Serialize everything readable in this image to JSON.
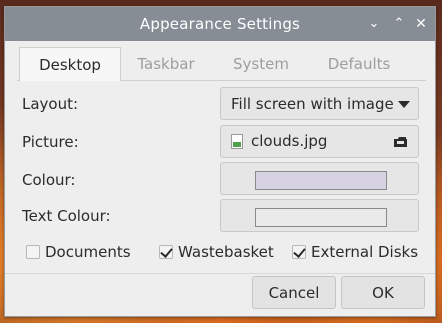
{
  "window": {
    "title": "Appearance Settings"
  },
  "tabs": [
    {
      "label": "Desktop"
    },
    {
      "label": "Taskbar"
    },
    {
      "label": "System"
    },
    {
      "label": "Defaults"
    }
  ],
  "form": {
    "layout": {
      "label": "Layout:",
      "value": "Fill screen with image"
    },
    "picture": {
      "label": "Picture:",
      "value": "clouds.jpg"
    },
    "colour": {
      "label": "Colour:",
      "color": "#d6d2e2"
    },
    "text_colour": {
      "label": "Text Colour:",
      "color": "#eaeaea"
    }
  },
  "checkboxes": [
    {
      "label": "Documents",
      "checked": false
    },
    {
      "label": "Wastebasket",
      "checked": true
    },
    {
      "label": "External Disks",
      "checked": true
    }
  ],
  "buttons": {
    "cancel": "Cancel",
    "ok": "OK"
  }
}
